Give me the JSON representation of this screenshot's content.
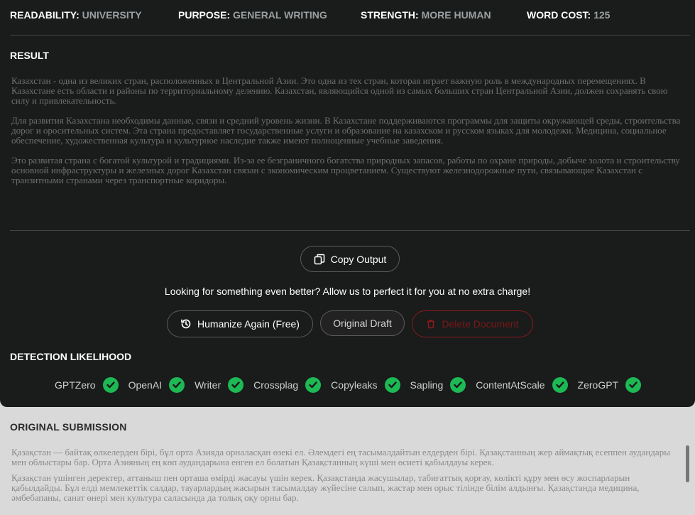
{
  "stats": [
    {
      "label": "READABILITY:",
      "value": "UNIVERSITY"
    },
    {
      "label": "PURPOSE:",
      "value": "GENERAL WRITING"
    },
    {
      "label": "STRENGTH:",
      "value": "MORE HUMAN"
    },
    {
      "label": "WORD COST:",
      "value": "125"
    }
  ],
  "result": {
    "title": "RESULT",
    "paragraphs": [
      "Казахстан - одна из великих стран, расположенных в Центральной Азии. Это одна из тех стран, которая играет важную роль в международных перемещениях. В Казахстане есть области и районы по территориальному делению. Казахстан, являющийся одной из самых больших стран Центральной Азии, должен сохранять свою силу и привлекательность.",
      "Для развития Казахстана необходимы данные, связи и средний уровень жизни. В Казахстане поддерживаются программы для защиты окружающей среды, строительства дорог и оросительных систем. Эта страна предоставляет государственные услуги и образование на казахском и русском языках для молодежи. Медицина, социальное обеспечение, художественная культура и культурное наследие также имеют полноценные учебные заведения.",
      "Это развитая страна с богатой культурой и традициями. Из-за ее безграничного богатства природных запасов, работы по охране природы, добыче золота и строительству основной инфраструктуры и железных дорог Казахстан связан с экономическим процветанием. Существуют железнодорожные пути, связывающие Казахстан с транзитными странами через транспортные коридоры."
    ]
  },
  "buttons": {
    "copy": "Copy Output",
    "humanize": "Humanize Again (Free)",
    "original": "Original Draft",
    "delete": "Delete Document"
  },
  "promo": "Looking for something even better? Allow us to perfect it for you at no extra charge!",
  "detection": {
    "title": "DETECTION LIKELIHOOD",
    "detectors": [
      "GPTZero",
      "OpenAI",
      "Writer",
      "Crossplag",
      "Copyleaks",
      "Sapling",
      "ContentAtScale",
      "ZeroGPT"
    ]
  },
  "original": {
    "title": "ORIGINAL SUBMISSION",
    "paragraphs": [
      "Қазақстан — байтақ өлкелерден бірі, бұл орта Азияда орналасқан өзекі ел. Әлемдегі ең тасымалдайтын елдерден бірі. Қазақстанның жер аймақтық есеппен аудандары мен облыстары бар. Орта Азияның ең көп аудандарына енген ел болатын Қазақстанның күші мен өсиеті қабылдауы керек.",
      "Қазақстан үшінген деректер, аттаныш пен орташа өмірді жасауы үшін керек. Қазақстанда жасушылар, табиғаттық қорғау, көлікті құру мен өсу жоспарларын қабылдайды. Бұл елді мемлекеттік салдар, тауарлардың жасырын тасымалдау жүйесіне салып, жастар мен орыс тілінде білім алдынғы. Қазақстанда медицина, әмбебапаны, санат өнері мен культура саласында да толық оқу орны бар."
    ]
  },
  "colors": {
    "check": "#1db954",
    "danger": "#b22222",
    "dark_bg": "#1a1b1b"
  }
}
